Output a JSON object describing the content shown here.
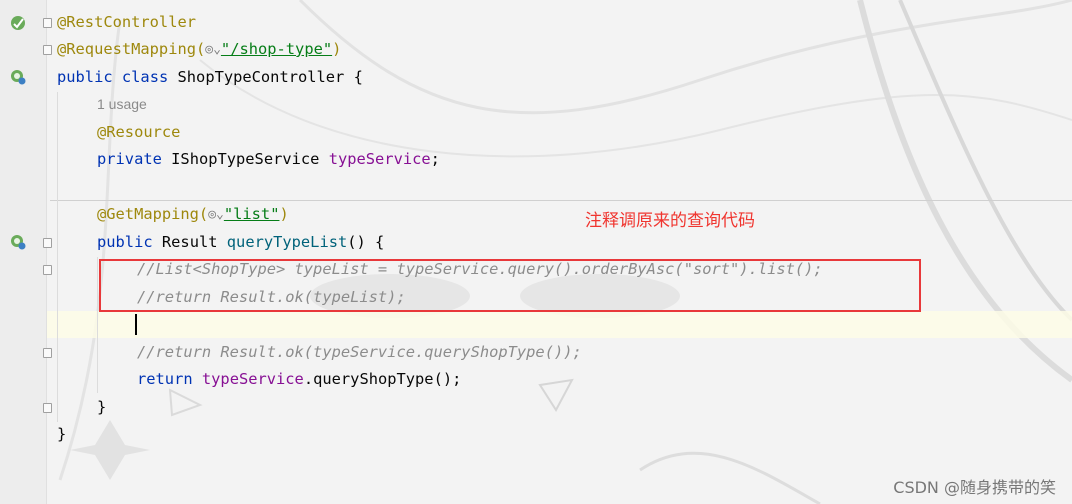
{
  "code": {
    "rest_controller": "@RestController",
    "request_mapping_open": "@RequestMapping(",
    "request_mapping_path": "\"/shop-type\"",
    "request_mapping_close": ")",
    "kw_public": "public",
    "kw_class": "class",
    "class_name": "ShopTypeController {",
    "usage_hint": "1 usage",
    "resource_annotation": "@Resource",
    "kw_private": "private",
    "field_type": "IShopTypeService",
    "field_name": "typeService",
    "semicolon": ";",
    "get_mapping_open": "@GetMapping(",
    "get_mapping_path": "\"list\"",
    "get_mapping_close": ")",
    "return_type": "Result",
    "method_name": "queryTypeList",
    "method_params": "() {",
    "comment_1": "//List<ShopType> typeList = typeService.query().orderByAsc(\"sort\").list();",
    "comment_2": "//return Result.ok(typeList);",
    "comment_3": "//return Result.ok(typeService.queryShopType());",
    "kw_return": "return",
    "return_target": "typeService",
    "return_dot": ".",
    "return_call": "queryShopType",
    "return_tail": "();",
    "close_method": "}",
    "close_class": "}"
  },
  "annotation_note": "注释调原来的查询代码",
  "watermark": "CSDN @随身携带的笑",
  "icons": {
    "web_endpoint": "globe-icon",
    "bean_gutter": "spring-bean-icon",
    "endpoint_gutter": "spring-endpoint-icon"
  },
  "colors": {
    "highlight_box": "#e8383a",
    "note_text": "#f0352f"
  }
}
